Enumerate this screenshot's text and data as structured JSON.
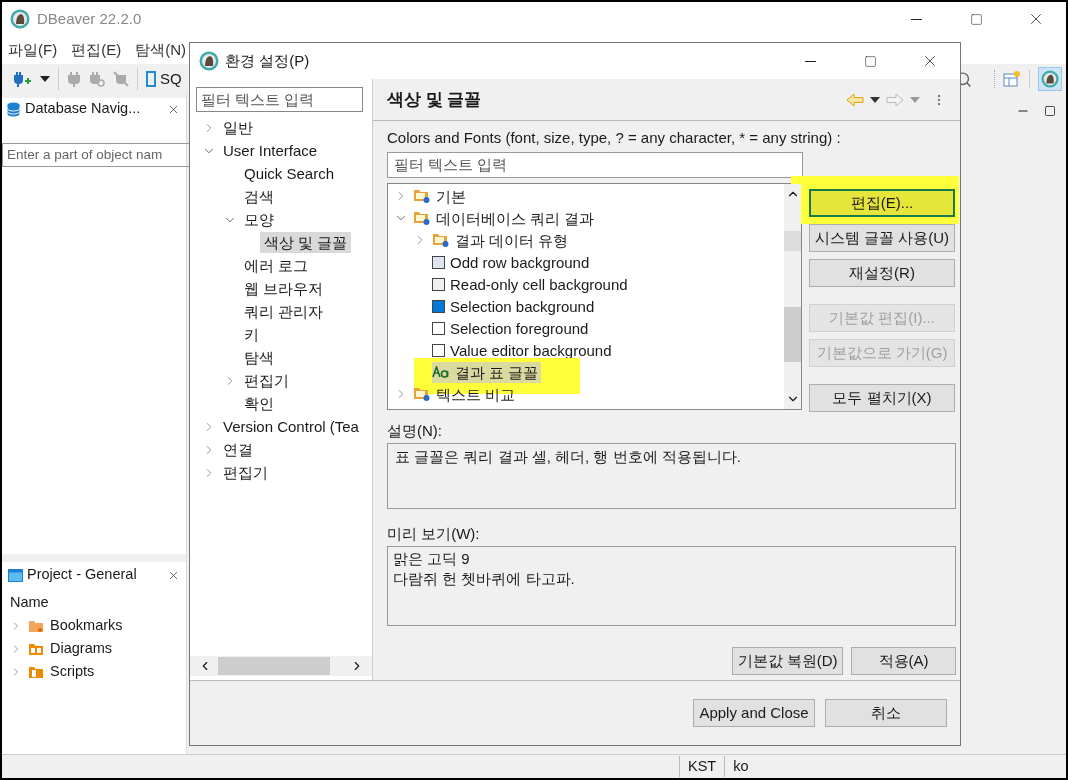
{
  "main_window": {
    "title": "DBeaver 22.2.0",
    "menu": [
      "파일(F)",
      "편집(E)",
      "탐색(N)"
    ],
    "toolbar": {
      "sql_label": "SQ"
    },
    "navigator": {
      "tab": "Database Navig...",
      "filter_placeholder": "Enter a part of object nam"
    },
    "project": {
      "tab": "Project - General",
      "column": "Name",
      "items": [
        {
          "label": "Bookmarks",
          "kind": "bookmark"
        },
        {
          "label": "Diagrams",
          "kind": "diagram"
        },
        {
          "label": "Scripts",
          "kind": "script"
        }
      ]
    },
    "status_bar": [
      "KST",
      "ko"
    ]
  },
  "dialog": {
    "title": "환경 설정(P)",
    "filter_placeholder": "필터 텍스트 입력",
    "tree": [
      {
        "label": "일반",
        "kind": "branch",
        "expanded": false,
        "selected": false
      },
      {
        "label": "User Interface",
        "kind": "branch",
        "expanded": true,
        "selected": false,
        "children": [
          {
            "label": "Quick Search",
            "kind": "leaf",
            "selected": false
          },
          {
            "label": "검색",
            "kind": "leaf",
            "selected": false
          },
          {
            "label": "모양",
            "kind": "branch",
            "expanded": true,
            "selected": false,
            "children": [
              {
                "label": "색상 및 글꼴",
                "kind": "leaf",
                "selected": true
              }
            ]
          },
          {
            "label": "에러 로그",
            "kind": "leaf",
            "selected": false
          },
          {
            "label": "웹 브라우저",
            "kind": "leaf",
            "selected": false
          },
          {
            "label": "쿼리 관리자",
            "kind": "leaf",
            "selected": false
          },
          {
            "label": "키",
            "kind": "leaf",
            "selected": false
          },
          {
            "label": "탐색",
            "kind": "leaf",
            "selected": false
          },
          {
            "label": "편집기",
            "kind": "branch",
            "expanded": false,
            "selected": false
          },
          {
            "label": "확인",
            "kind": "leaf",
            "selected": false
          }
        ]
      },
      {
        "label": "Version Control (Tea",
        "kind": "branch",
        "expanded": false,
        "selected": false
      },
      {
        "label": "연결",
        "kind": "branch",
        "expanded": false,
        "selected": false
      },
      {
        "label": "편집기",
        "kind": "branch",
        "expanded": false,
        "selected": false
      }
    ],
    "page_title": "색상 및 글꼴",
    "intro": "Colors and Fonts (font, size, type, ? = any character, * = any string) :",
    "list_filter_placeholder": "필터 텍스트 입력",
    "fonts_tree": [
      {
        "label": "기본",
        "kind": "folder",
        "expanded": false,
        "selected": false,
        "highlighted": false
      },
      {
        "label": "데이터베이스 쿼리 결과",
        "kind": "folder",
        "expanded": true,
        "selected": false,
        "highlighted": false,
        "children": [
          {
            "label": "결과 데이터 유형",
            "kind": "folder",
            "expanded": false,
            "selected": false,
            "highlighted": false
          },
          {
            "label": "Odd row background",
            "kind": "color",
            "color": "#dde4ee",
            "selected": false,
            "highlighted": false
          },
          {
            "label": "Read-only cell background",
            "kind": "color",
            "color": "#f0f0f0",
            "selected": false,
            "highlighted": false
          },
          {
            "label": "Selection background",
            "kind": "color",
            "color": "#0078d7",
            "selected": false,
            "highlighted": false
          },
          {
            "label": "Selection foreground",
            "kind": "color",
            "color": "#ffffff",
            "selected": false,
            "highlighted": false
          },
          {
            "label": "Value editor background",
            "kind": "color",
            "color": "#ffffff",
            "selected": false,
            "highlighted": false
          },
          {
            "label": "결과 표 글꼴",
            "kind": "font",
            "selected": true,
            "highlighted": true
          }
        ]
      },
      {
        "label": "텍스트 비교",
        "kind": "folder",
        "expanded": false,
        "selected": false,
        "highlighted": false
      }
    ],
    "side_buttons": [
      {
        "label": "편집(E)...",
        "disabled": false,
        "default": true,
        "highlighted": true
      },
      {
        "label": "시스템 글꼴 사용(U)",
        "disabled": false,
        "default": false,
        "highlighted": false
      },
      {
        "label": "재설정(R)",
        "disabled": false,
        "default": false,
        "highlighted": false
      },
      {
        "label": "기본값 편집(I)...",
        "disabled": true,
        "default": false,
        "highlighted": false
      },
      {
        "label": "기본값으로 가기(G)",
        "disabled": true,
        "default": false,
        "highlighted": false
      },
      {
        "label": "모두 펼치기(X)",
        "disabled": false,
        "default": false,
        "highlighted": false
      }
    ],
    "description_label": "설명(N):",
    "description": "표 글꼴은 쿼리 결과 셀, 헤더, 행 번호에 적용됩니다.",
    "preview_label": "미리 보기(W):",
    "preview": [
      "맑은 고딕 9",
      "다람쥐 헌 쳇바퀴에 타고파."
    ],
    "page_buttons": [
      "기본값 복원(D)",
      "적용(A)"
    ],
    "footer_buttons": [
      "Apply and Close",
      "취소"
    ]
  }
}
